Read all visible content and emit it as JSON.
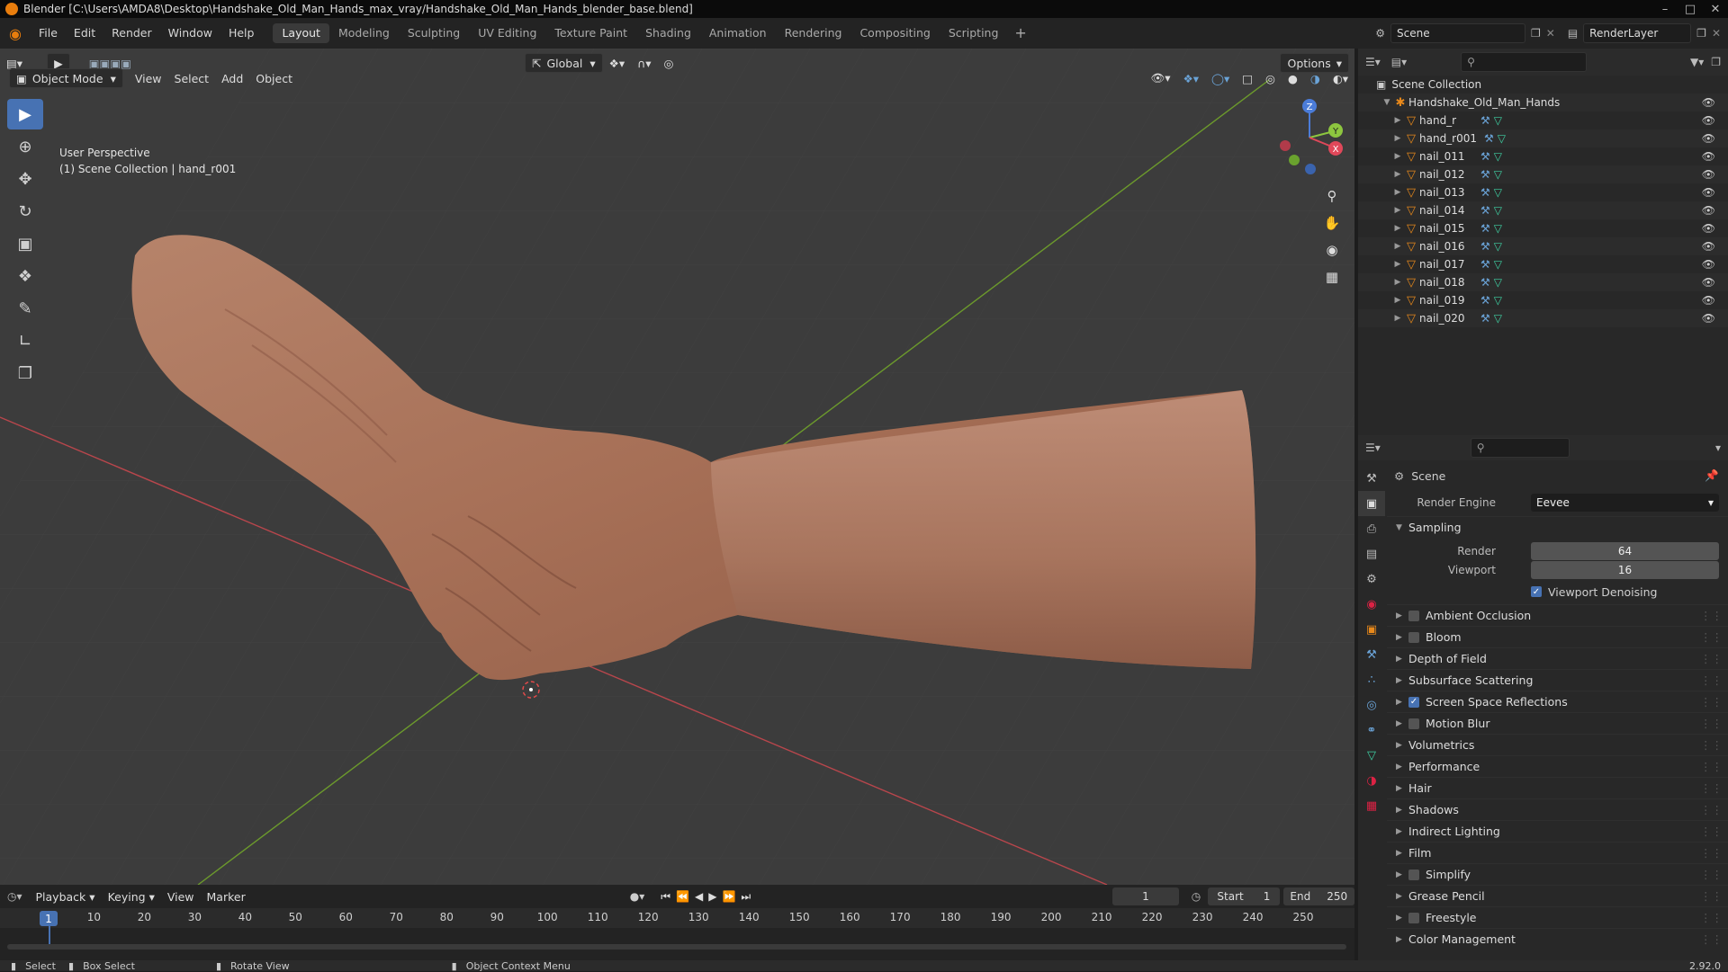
{
  "window": {
    "title": "Blender [C:\\Users\\AMDA8\\Desktop\\Handshake_Old_Man_Hands_max_vray/Handshake_Old_Man_Hands_blender_base.blend]"
  },
  "menu": [
    "File",
    "Edit",
    "Render",
    "Window",
    "Help"
  ],
  "workspaces": [
    "Layout",
    "Modeling",
    "Sculpting",
    "UV Editing",
    "Texture Paint",
    "Shading",
    "Animation",
    "Rendering",
    "Compositing",
    "Scripting"
  ],
  "top_right": {
    "scene": "Scene",
    "view_layer": "RenderLayer"
  },
  "viewport": {
    "mode": "Object Mode",
    "menus": [
      "View",
      "Select",
      "Add",
      "Object"
    ],
    "orientation": "Global",
    "options": "Options",
    "info_line1": "User Perspective",
    "info_line2": "(1) Scene Collection | hand_r001"
  },
  "gizmo": {
    "z": "Z",
    "y": "Y",
    "x": "X"
  },
  "outliner": {
    "root": "Scene Collection",
    "collection": "Handshake_Old_Man_Hands",
    "objects": [
      "hand_r",
      "hand_r001",
      "nail_011",
      "nail_012",
      "nail_013",
      "nail_014",
      "nail_015",
      "nail_016",
      "nail_017",
      "nail_018",
      "nail_019",
      "nail_020"
    ]
  },
  "properties": {
    "context": "Scene",
    "render_engine_label": "Render Engine",
    "render_engine": "Eevee",
    "sampling": "Sampling",
    "render_label": "Render",
    "render_samples": "64",
    "viewport_label": "Viewport",
    "viewport_samples": "16",
    "viewport_denoising": "Viewport Denoising",
    "sections": [
      {
        "label": "Ambient Occlusion",
        "checkbox": true,
        "checked": false
      },
      {
        "label": "Bloom",
        "checkbox": true,
        "checked": false
      },
      {
        "label": "Depth of Field",
        "checkbox": false,
        "checked": false
      },
      {
        "label": "Subsurface Scattering",
        "checkbox": false,
        "checked": false
      },
      {
        "label": "Screen Space Reflections",
        "checkbox": true,
        "checked": true
      },
      {
        "label": "Motion Blur",
        "checkbox": true,
        "checked": false
      },
      {
        "label": "Volumetrics",
        "checkbox": false,
        "checked": false
      },
      {
        "label": "Performance",
        "checkbox": false,
        "checked": false
      },
      {
        "label": "Hair",
        "checkbox": false,
        "checked": false
      },
      {
        "label": "Shadows",
        "checkbox": false,
        "checked": false
      },
      {
        "label": "Indirect Lighting",
        "checkbox": false,
        "checked": false
      },
      {
        "label": "Film",
        "checkbox": false,
        "checked": false
      },
      {
        "label": "Simplify",
        "checkbox": true,
        "checked": false
      },
      {
        "label": "Grease Pencil",
        "checkbox": false,
        "checked": false
      },
      {
        "label": "Freestyle",
        "checkbox": true,
        "checked": false
      },
      {
        "label": "Color Management",
        "checkbox": false,
        "checked": false
      }
    ]
  },
  "timeline": {
    "menus": [
      "Playback",
      "Keying",
      "View",
      "Marker"
    ],
    "current_frame": "1",
    "start_label": "Start",
    "start": "1",
    "end_label": "End",
    "end": "250",
    "ticks": [
      "1",
      "10",
      "20",
      "30",
      "40",
      "50",
      "60",
      "70",
      "80",
      "90",
      "100",
      "110",
      "120",
      "130",
      "140",
      "150",
      "160",
      "170",
      "180",
      "190",
      "200",
      "210",
      "220",
      "230",
      "240",
      "250"
    ]
  },
  "status": {
    "select": "Select",
    "box_select": "Box Select",
    "rotate": "Rotate View",
    "context_menu": "Object Context Menu",
    "version": "2.92.0"
  }
}
